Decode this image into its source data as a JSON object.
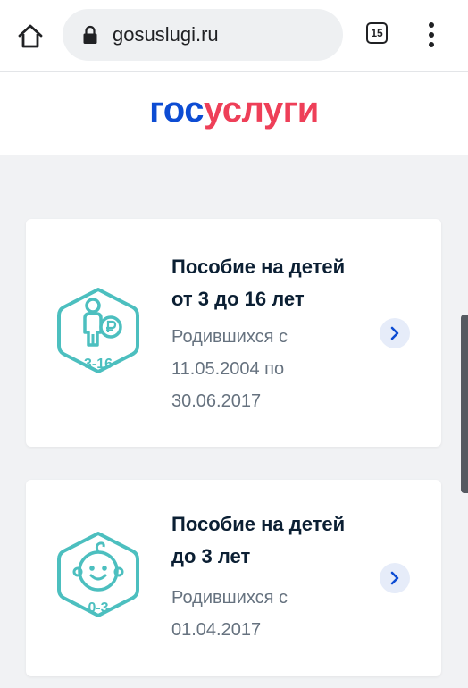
{
  "browser": {
    "url": "gosuslugi.ru",
    "tab_count": "15",
    "icons": [
      "home-icon",
      "lock-icon",
      "tabs-icon",
      "more-vert-icon"
    ]
  },
  "site": {
    "logo_part1": "гос",
    "logo_part2": "услуги",
    "logo_colors": {
      "blue": "#0d4cd3",
      "red": "#ee3f58"
    }
  },
  "cards": [
    {
      "title_line1": "Пособие на детей",
      "title_line2": "от 3 до 16 лет",
      "desc_line1": "Родившихся с",
      "desc_line2": "11.05.2004 по",
      "desc_line3": "30.06.2017",
      "icon": "child-ruble-icon",
      "icon_label": "3-16"
    },
    {
      "title_line1": "Пособие на детей",
      "title_line2": "до 3 лет",
      "desc_line1": "Родившихся с",
      "desc_line2": "01.04.2017",
      "icon": "baby-face-icon",
      "icon_label": "0-3"
    }
  ],
  "colors": {
    "icon_teal": "#4cbfbf",
    "chevron_bg": "#e6ecf9",
    "chevron": "#0d4cd3"
  }
}
